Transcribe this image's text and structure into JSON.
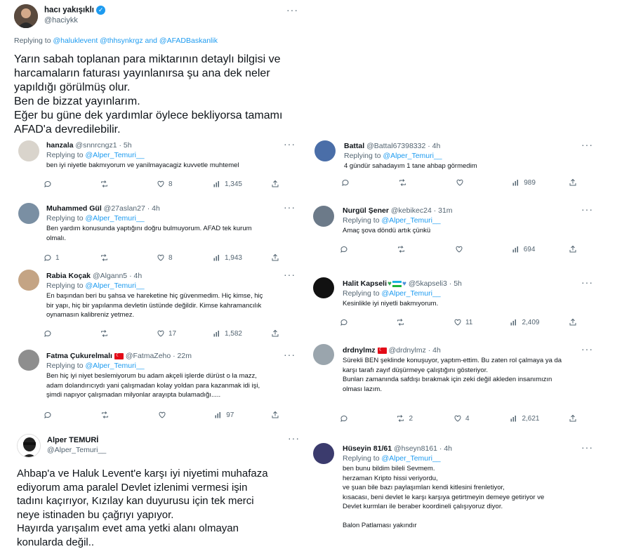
{
  "main_tweet": {
    "name": "hacı yakışıklı",
    "handle": "@haciykk",
    "replying_prefix": "Replying to",
    "replying_to": "@haluklevent @thhsynkrgz and @AFADBaskanlik",
    "text": "Yarın sabah toplanan para miktarının detaylı bilgisi ve\nharcamaların faturası yayınlanırsa şu ana dek neler\nyapıldığı görülmüş olur.\nBen de bizzat yayınlarım.\nEğer bu güne dek yardımlar öylece bekliyorsa tamamı\nAFAD'a devredilebilir."
  },
  "left_replies": [
    {
      "name": "hanzala",
      "handle": "@snnrcngz1",
      "time": "· 5h",
      "replying_prefix": "Replying to",
      "replying_to": "@Alper_Temuri__",
      "text": "ben iyi niyetle bakmıyorum ve yanilmayacagiz kuvvetle muhtemel",
      "replies": "",
      "retweets": "",
      "likes": "8",
      "views": "1,345"
    },
    {
      "name": "Muhammed Gül",
      "handle": "@27aslan27",
      "time": "· 4h",
      "replying_prefix": "Replying to",
      "replying_to": "@Alper_Temuri__",
      "text": "Ben yardım konusunda yaptığını doğru bulmuyorum. AFAD tek kurum\nolmalı.",
      "replies": "1",
      "retweets": "",
      "likes": "8",
      "views": "1,943"
    },
    {
      "name": "Rabia Koçak",
      "handle": "@Algann5",
      "time": "· 4h",
      "replying_prefix": "Replying to",
      "replying_to": "@Alper_Temuri__",
      "text": "En başından beri bu şahsa ve hareketine hiç güvenmedim. Hiç kimse, hiç\nbir yapı, hiç bir yapılanma devletin üstünde değildir. Kimse kahramancılık\noynamasın kalibreniz yetmez.",
      "replies": "",
      "retweets": "",
      "likes": "17",
      "views": "1,582"
    },
    {
      "name": "Fatma Çukurelmalı",
      "handle": "@FatmaZeho",
      "time": "· 22m",
      "replying_prefix": "Replying to",
      "replying_to": "@Alper_Temuri__",
      "text": "Ben hiç iyi niyet beslemiyorum bu adam akçeli işlerde dürüst  o la mazz,\nadam dolandırıcıydı yani çalışmadan kolay yoldan para kazanmak idi işi,\nşimdi napıyor çalışmadan milyonlar arayıpta bulamadığı.....",
      "replies": "",
      "retweets": "",
      "likes": "",
      "views": "97"
    }
  ],
  "alper_tweet": {
    "name": "Alper TEMURİ",
    "handle": "@Alper_Temuri__",
    "text": "Ahbap'a ve Haluk Levent'e karşı iyi niyetimi muhafaza\nediyorum ama paralel Devlet izlenimi vermesi işin\ntadını kaçırıyor, Kızılay kan duyurusu için tek merci\nneye istinaden bu çağrıyı yapıyor.\nHayırda yarışalım evet ama yetki alanı olmayan\nkonularda değil.."
  },
  "right_replies": [
    {
      "name": "Battal",
      "handle": "@Battal67398332",
      "time": "· 4h",
      "replying_prefix": "Replying to",
      "replying_to": "@Alper_Temuri__",
      "text": "4 gündür sahadayım 1 tane ahbap görmedim",
      "replies": "",
      "retweets": "",
      "likes": "",
      "views": "989"
    },
    {
      "name": "Nurgül Şener",
      "handle": "@kebikec24",
      "time": "· 31m",
      "replying_prefix": "Replying to",
      "replying_to": "@Alper_Temuri__",
      "text": "Amaç şova döndü artık çünkü",
      "replies": "",
      "retweets": "",
      "likes": "",
      "views": "694"
    },
    {
      "name": "Halit Kapseli",
      "handle": "@5kapseli3",
      "time": "· 5h",
      "replying_prefix": "Replying to",
      "replying_to": "@Alper_Temuri__",
      "text": "Kesinlikle iyi niyetli bakmıyorum.",
      "replies": "",
      "retweets": "",
      "likes": "11",
      "views": "2,409"
    },
    {
      "name": "drdnylmz",
      "handle": "@drdnylmz",
      "time": "· 4h",
      "replying_prefix": "",
      "replying_to": "",
      "text": "Sürekli BEN şeklinde konuşuyor, yaptım-ettim. Bu zaten rol çalmaya ya da\nkarşı tarafı zayıf düşürmeye çalıştığını gösteriyor.\nBunları zamanında safdışı bırakmak için zeki değil akleden insanımızın\nolması lazım.",
      "replies": "",
      "retweets": "2",
      "likes": "4",
      "views": "2,621"
    },
    {
      "name": "Hüseyin 81/61",
      "handle": "@hseyn8161",
      "time": "· 4h",
      "replying_prefix": "Replying to",
      "replying_to": "@Alper_Temuri__",
      "text": "ben bunu bildim bileli Sevmem.\nherzaman Kripto hissi veriyordu,\nve şuan bile bazı paylaşımları kendi kitlesini frenletiyor,\nkısacası, beni devlet le karşı karşıya getirtmeyin demeye getiriyor ve\nDevlet kurmları ile beraber koordineli çalışıyoruz diyor.\n\nBalon Patlaması yakındır"
    }
  ]
}
